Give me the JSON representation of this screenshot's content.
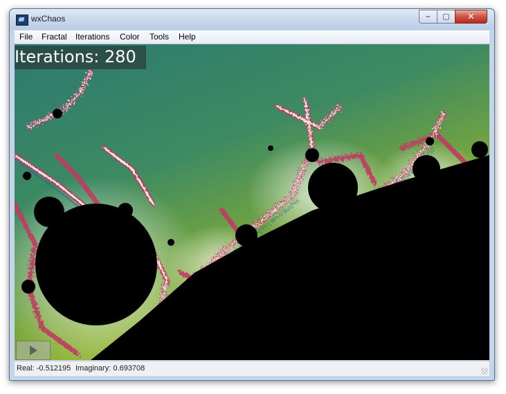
{
  "window": {
    "title": "wxChaos"
  },
  "titlebar": {
    "minimize_icon": "minimize-icon",
    "maximize_icon": "maximize-icon",
    "close_icon": "close-icon",
    "minimize_glyph": "–",
    "maximize_glyph": "▢",
    "close_glyph": "✕"
  },
  "menu": [
    "File",
    "Fractal",
    "Iterations",
    "Color",
    "Tools",
    "Help"
  ],
  "canvas": {
    "iterations_label": "Iterations: 280",
    "play_icon": "play-icon"
  },
  "status": {
    "real": "Real: -0.512195",
    "imaginary": "Imaginary: 0.693708"
  },
  "colors": {
    "fractal_black": "#000000",
    "edge_pink": "#d8567a",
    "edge_white": "#f4f4ee",
    "background_green": "#3d8a62",
    "background_yellow": "#a9c42a"
  }
}
